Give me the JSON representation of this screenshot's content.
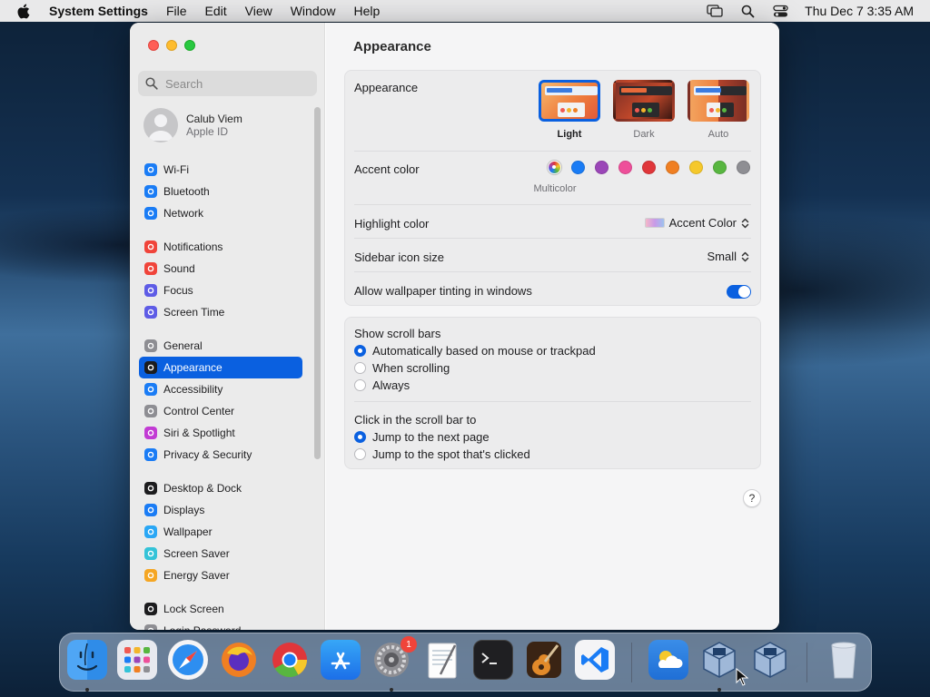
{
  "menubar": {
    "app_name": "System Settings",
    "menus": [
      "File",
      "Edit",
      "View",
      "Window",
      "Help"
    ],
    "clock": "Thu Dec 7  3:35 AM"
  },
  "search": {
    "placeholder": "Search"
  },
  "profile": {
    "name": "Calub Viem",
    "subtitle": "Apple ID"
  },
  "sidebar": {
    "items": [
      {
        "label": "Wi-Fi",
        "icon": "wifi-icon",
        "color": "#1a7cf5"
      },
      {
        "label": "Bluetooth",
        "icon": "bluetooth-icon",
        "color": "#1a7cf5"
      },
      {
        "label": "Network",
        "icon": "network-icon",
        "color": "#1a7cf5"
      },
      {
        "label": "Notifications",
        "icon": "notifications-icon",
        "color": "#f0443a"
      },
      {
        "label": "Sound",
        "icon": "sound-icon",
        "color": "#f0443a"
      },
      {
        "label": "Focus",
        "icon": "focus-icon",
        "color": "#5e5ce6"
      },
      {
        "label": "Screen Time",
        "icon": "screen-time-icon",
        "color": "#5e5ce6"
      },
      {
        "label": "General",
        "icon": "gear-icon",
        "color": "#8e8e93"
      },
      {
        "label": "Appearance",
        "icon": "appearance-icon",
        "color": "#1c1c1e"
      },
      {
        "label": "Accessibility",
        "icon": "accessibility-icon",
        "color": "#1a7cf5"
      },
      {
        "label": "Control Center",
        "icon": "control-center-icon",
        "color": "#8e8e93"
      },
      {
        "label": "Siri & Spotlight",
        "icon": "siri-icon",
        "color": "#c23bd4"
      },
      {
        "label": "Privacy & Security",
        "icon": "hand-icon",
        "color": "#1a7cf5"
      },
      {
        "label": "Desktop & Dock",
        "icon": "desktop-dock-icon",
        "color": "#1c1c1e"
      },
      {
        "label": "Displays",
        "icon": "displays-icon",
        "color": "#1a7cf5"
      },
      {
        "label": "Wallpaper",
        "icon": "wallpaper-icon",
        "color": "#2aa7f5"
      },
      {
        "label": "Screen Saver",
        "icon": "screen-saver-icon",
        "color": "#34c3d8"
      },
      {
        "label": "Energy Saver",
        "icon": "energy-saver-icon",
        "color": "#f5a623"
      },
      {
        "label": "Lock Screen",
        "icon": "lock-icon",
        "color": "#1c1c1e"
      },
      {
        "label": "Login Password",
        "icon": "password-icon",
        "color": "#8e8e93"
      }
    ],
    "active": "Appearance"
  },
  "main": {
    "title": "Appearance",
    "appearance": {
      "label": "Appearance",
      "options": [
        "Light",
        "Dark",
        "Auto"
      ],
      "selected": "Light"
    },
    "accent": {
      "label": "Accent color",
      "selected_label": "Multicolor",
      "colors": [
        "#1a7cf5",
        "#9b46b8",
        "#ee4f9a",
        "#e0363a",
        "#f07f22",
        "#f5c82b",
        "#58b640",
        "#8e8e93"
      ]
    },
    "highlight": {
      "label": "Highlight color",
      "value": "Accent Color"
    },
    "sidebar_icon_size": {
      "label": "Sidebar icon size",
      "value": "Small"
    },
    "wallpaper_tinting": {
      "label": "Allow wallpaper tinting in windows",
      "enabled": true
    },
    "scroll_bars": {
      "label": "Show scroll bars",
      "options": [
        "Automatically based on mouse or trackpad",
        "When scrolling",
        "Always"
      ],
      "selected": "Automatically based on mouse or trackpad"
    },
    "click_scroll_bar": {
      "label": "Click in the scroll bar to",
      "options": [
        "Jump to the next page",
        "Jump to the spot that's clicked"
      ],
      "selected": "Jump to the next page"
    },
    "help": "?"
  },
  "dock": {
    "apps": [
      "Finder",
      "Launchpad",
      "Safari",
      "Firefox",
      "Chrome",
      "App Store",
      "System Settings",
      "TextEdit",
      "Terminal",
      "GarageBand",
      "Visual Studio Code",
      "Weather",
      "VirtualBox",
      "VirtualBox VM",
      "Trash"
    ],
    "settings_badge": "1"
  }
}
